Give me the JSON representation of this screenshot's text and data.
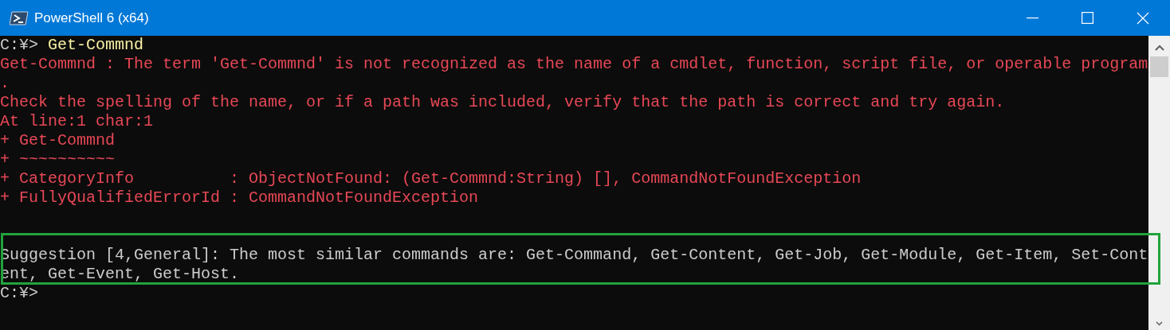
{
  "window": {
    "title": "PowerShell 6 (x64)"
  },
  "console": {
    "lines": [
      {
        "segments": [
          {
            "kind": "prompt",
            "text": "C:¥>"
          },
          {
            "kind": "input",
            "text": "Get-Commnd"
          }
        ]
      },
      {
        "segments": [
          {
            "kind": "error",
            "text": "Get-Commnd : The term 'Get-Commnd' is not recognized as the name of a cmdlet, function, script file, or operable program"
          }
        ]
      },
      {
        "segments": [
          {
            "kind": "error",
            "text": "."
          }
        ]
      },
      {
        "segments": [
          {
            "kind": "error",
            "text": "Check the spelling of the name, or if a path was included, verify that the path is correct and try again."
          }
        ]
      },
      {
        "segments": [
          {
            "kind": "error",
            "text": "At line:1 char:1"
          }
        ]
      },
      {
        "segments": [
          {
            "kind": "error",
            "text": "+ Get-Commnd"
          }
        ]
      },
      {
        "segments": [
          {
            "kind": "error",
            "text": "+ ~~~~~~~~~~"
          }
        ]
      },
      {
        "segments": [
          {
            "kind": "error",
            "text": "+ CategoryInfo          : ObjectNotFound: (Get-Commnd:String) [], CommandNotFoundException"
          }
        ]
      },
      {
        "segments": [
          {
            "kind": "error",
            "text": "+ FullyQualifiedErrorId : CommandNotFoundException"
          }
        ]
      },
      {
        "kind": "blank"
      },
      {
        "kind": "blank"
      },
      {
        "segments": [
          {
            "kind": "output",
            "text": "Suggestion [4,General]: The most similar commands are: Get-Command, Get-Content, Get-Job, Get-Module, Get-Item, Set-Cont"
          }
        ]
      },
      {
        "segments": [
          {
            "kind": "output",
            "text": "ent, Get-Event, Get-Host."
          }
        ]
      },
      {
        "segments": [
          {
            "kind": "prompt",
            "text": "C:¥>"
          }
        ]
      }
    ]
  }
}
